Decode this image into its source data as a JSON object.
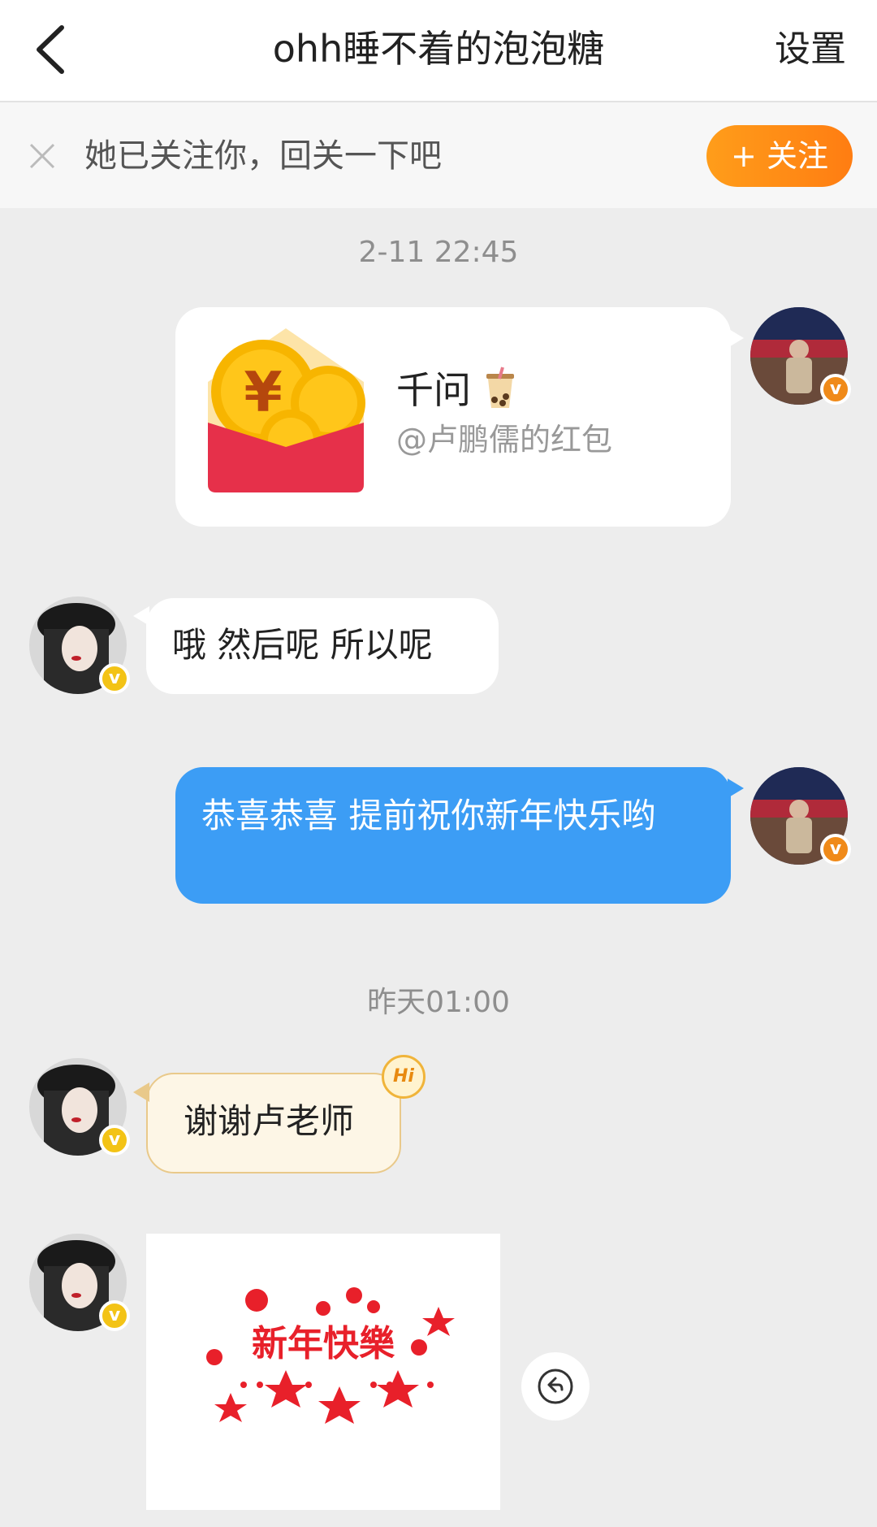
{
  "header": {
    "title": "ohh睡不着的泡泡糖",
    "settings_label": "设置"
  },
  "follow_banner": {
    "text": "她已关注你，回关一下吧",
    "button_label": "+ 关注"
  },
  "messages": [
    {
      "type": "timestamp",
      "text": "2-11 22:45"
    },
    {
      "type": "red_packet",
      "side": "right",
      "title": "千问",
      "subtitle": "@卢鹏儒的红包"
    },
    {
      "type": "text",
      "side": "left",
      "text": "哦 然后呢 所以呢"
    },
    {
      "type": "text",
      "side": "right",
      "text": "恭喜恭喜 提前祝你新年快乐哟"
    },
    {
      "type": "timestamp",
      "text": "昨天01:00"
    },
    {
      "type": "text",
      "side": "left",
      "style": "greeting",
      "text": "谢谢卢老师",
      "tag": "Hi"
    },
    {
      "type": "image",
      "side": "left",
      "caption": "新年快樂"
    }
  ],
  "colors": {
    "accent_orange": "#ff8a15",
    "sent_bubble": "#3c9df5",
    "background": "#ededed"
  }
}
